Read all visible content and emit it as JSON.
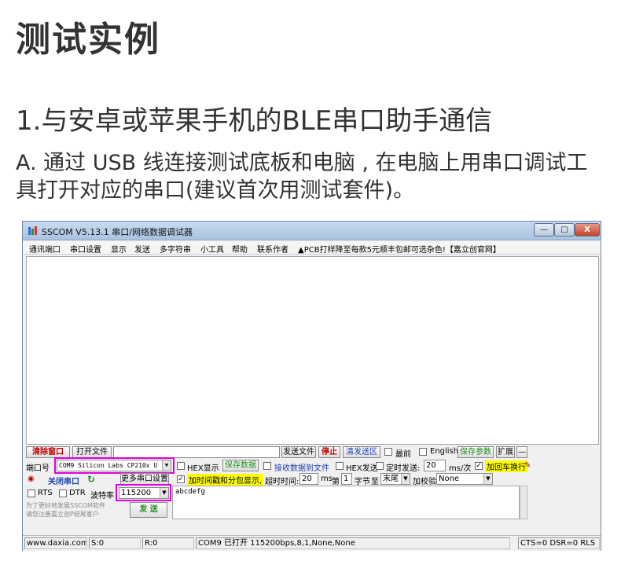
{
  "doc": {
    "title": "测试实例",
    "heading": "1.与安卓或苹果手机的BLE串口助手通信",
    "paragraph": "A. 通过 USB 线连接测试底板和电脑 , 在电脑上用串口调试工具打开对应的串口(建议首次用测试套件)。"
  },
  "window": {
    "title": "SSCOM V5.13.1 串口/网络数据调试器",
    "min": "—",
    "max": "□",
    "close": "X"
  },
  "menu": [
    "通讯端口",
    "串口设置",
    "显示",
    "发送",
    "多字符串",
    "小工具",
    "帮助",
    "联系作者",
    "▲PCB打样降至每款5元顺丰包邮可选杂色!【嘉立创官网】"
  ],
  "toolbar": {
    "clear_window": "清除窗口",
    "open_file": "打开文件",
    "send_file": "发送文件",
    "stop": "停止",
    "clear_send": "清发送区",
    "front": "最前",
    "english": "English",
    "save_params": "保存参数",
    "expand": "扩展",
    "collapse": "—"
  },
  "serial": {
    "port_label": "端口号",
    "port_value": "COM9 Silicon Labs CP210x U",
    "close_port": "关闭串口",
    "more_settings": "更多串口设置",
    "rts": "RTS",
    "dtr": "DTR",
    "baud_label": "波特率",
    "baud_value": "115200",
    "promo": "为了更好地发展SSCOM软件\n请您注册嘉立创P结尾客户",
    "send": "发 送"
  },
  "options": {
    "hex_display": "HEX显示",
    "save_data": "保存数据",
    "recv_to_file": "接收数据到文件",
    "hex_send": "HEX发送",
    "timed_send": "定时发送:",
    "interval": "20",
    "interval_unit": "ms/次",
    "append_crlf": "加回车换行",
    "timestamp": "加时间戳和分包显示,",
    "timeout_label": "超时时间:",
    "timeout_value": "20",
    "timeout_unit": "ms",
    "byte_index_label": "第",
    "byte_index": "1",
    "byte_label": "字节",
    "to_label": "至",
    "to_value": "末尾",
    "checksum_label": "加校验",
    "checksum_value": "None"
  },
  "send_text": "abcdefg",
  "status": {
    "site": "www.daxia.com",
    "s": "S:0",
    "r": "R:0",
    "port": "COM9 已打开  115200bps,8,1,None,None",
    "signals": "CTS=0 DSR=0 RLS"
  },
  "colors": {
    "highlight": "#ffff00",
    "annotation": "#e000e0",
    "accent_green": "#1a8a1a",
    "accent_red": "#c00000"
  }
}
